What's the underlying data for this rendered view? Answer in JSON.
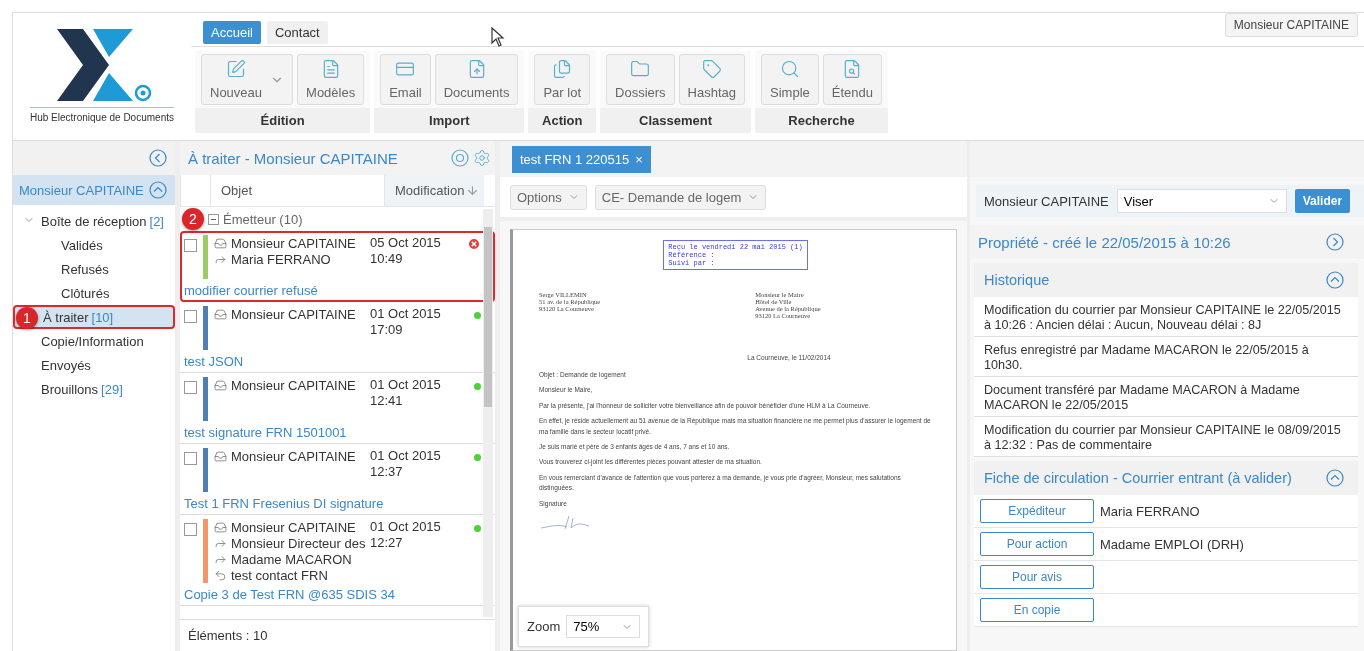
{
  "logo": {
    "caption": "Hub Electronique de Documents"
  },
  "tabs": [
    {
      "label": "Accueil",
      "selected": true
    },
    {
      "label": "Contact",
      "selected": false
    }
  ],
  "user_menu": {
    "label": "Monsieur CAPITAINE"
  },
  "ribbon": [
    {
      "title": "Édition",
      "buttons": [
        {
          "label": "Nouveau",
          "kind": "edit",
          "dropdown": true
        },
        {
          "label": "Modèles",
          "kind": "template",
          "dropdown": false
        }
      ]
    },
    {
      "title": "Import",
      "buttons": [
        {
          "label": "Email",
          "kind": "email",
          "dropdown": false
        },
        {
          "label": "Documents",
          "kind": "upload",
          "dropdown": false
        }
      ]
    },
    {
      "title": "Action",
      "buttons": [
        {
          "label": "Par lot",
          "kind": "stack",
          "dropdown": false
        }
      ]
    },
    {
      "title": "Classement",
      "buttons": [
        {
          "label": "Dossiers",
          "kind": "folder",
          "dropdown": false
        },
        {
          "label": "Hashtag",
          "kind": "tag",
          "dropdown": false
        }
      ]
    },
    {
      "title": "Recherche",
      "buttons": [
        {
          "label": "Simple",
          "kind": "search",
          "dropdown": false
        },
        {
          "label": "Étendu",
          "kind": "searchdoc",
          "dropdown": false
        }
      ]
    }
  ],
  "sidebar": {
    "account": "Monsieur CAPITAINE",
    "items": [
      {
        "label": "Boîte de réception",
        "count": "[2]",
        "selected": false,
        "expanded": true,
        "children": [
          {
            "label": "Validés",
            "selected": false
          },
          {
            "label": "Refusés",
            "selected": false
          },
          {
            "label": "Clôturés",
            "selected": false
          }
        ]
      },
      {
        "label": "À traiter",
        "count": "[10]",
        "selected": true,
        "callout": "1"
      },
      {
        "label": "Copie/Information",
        "selected": false
      },
      {
        "label": "Envoyés",
        "selected": false
      },
      {
        "label": "Brouillons",
        "count": "[29]",
        "selected": false
      }
    ]
  },
  "list": {
    "title": "À traiter - Monsieur CAPITAINE",
    "columns": [
      "Objet",
      "Modification"
    ],
    "group": "Émetteur (10)",
    "rows": [
      {
        "checked": false,
        "color": "#9ccc65",
        "kind": "refused",
        "date": "05 Oct 2015",
        "time": "10:49",
        "callout": "2",
        "lines": [
          {
            "kind": "from",
            "text": "Monsieur CAPITAINE"
          },
          {
            "kind": "to",
            "text": "Maria FERRANO"
          }
        ],
        "subject": "modifier courrier refusé"
      },
      {
        "checked": false,
        "color": "#4f7fb5",
        "kind": "ok",
        "date": "01 Oct 2015",
        "time": "17:09",
        "lines": [
          {
            "kind": "from",
            "text": "Monsieur CAPITAINE"
          }
        ],
        "subject": "test JSON"
      },
      {
        "checked": false,
        "color": "#4f7fb5",
        "kind": "ok",
        "date": "01 Oct 2015",
        "time": "12:41",
        "lines": [
          {
            "kind": "from",
            "text": "Monsieur CAPITAINE"
          }
        ],
        "subject": "test signature FRN 1501001"
      },
      {
        "checked": false,
        "color": "#4f7fb5",
        "kind": "ok",
        "date": "01 Oct 2015",
        "time": "12:37",
        "lines": [
          {
            "kind": "from",
            "text": "Monsieur CAPITAINE"
          }
        ],
        "subject": "Test 1 FRN Fresenius DI signature"
      },
      {
        "checked": false,
        "color": "#f4956a",
        "kind": "ok",
        "date": "01 Oct 2015",
        "time": "12:27",
        "lines": [
          {
            "kind": "from",
            "text": "Monsieur CAPITAINE"
          },
          {
            "kind": "to",
            "text": "Monsieur Directeur des"
          },
          {
            "kind": "to",
            "text": "Madame MACARON"
          },
          {
            "kind": "reply",
            "text": "test contact FRN"
          }
        ],
        "subject": "Copie 3 de Test FRN @635 SDIS 34"
      }
    ],
    "footer": "Éléments : 10"
  },
  "viewer": {
    "tab": "test FRN 1 220515",
    "tab_close": "×",
    "options": "Options",
    "template": "CE- Demande de logem",
    "zoom_label": "Zoom",
    "zoom": "75%",
    "document": {
      "stamp": [
        "Reçu le vendredi 22 mai 2015 (1)",
        "Référence :",
        "Suivi par :"
      ],
      "sender": [
        "Serge VILLEMIN",
        "51 av. de la République",
        "93120 La Courneuve"
      ],
      "recipient": [
        "Monsieur le Maire",
        "Hôtel de Ville",
        "Avenue de la République",
        "93120 La Courneuve"
      ],
      "date": "La Courneuve, le 11/02/2014",
      "paragraphs": [
        "Objet : Demande de logement",
        "Monsieur le Maire,",
        "Par la présente, j'ai l'honneur de solliciter votre bienveillance afin de pouvoir bénéficier d'une HLM à La Courneuve.",
        "En effet, je réside actuellement au 51 avenue de la République mais ma situation financière ne me permet plus d'assurer le logement de ma famille dans le secteur locatif privé.",
        "Je suis marié et père de 3 enfants âgés de 4 ans, 7 ans et 10 ans.",
        "Vous trouverez ci-joint les différentes pièces pouvant attester de ma situation.",
        "En vous remerciant d'avance de l'attention que vous porterez à ma demande, je vous prie d'agréer, Monsieur, mes salutations distinguées.",
        "Signature"
      ]
    }
  },
  "details": {
    "actor": "Monsieur CAPITAINE",
    "action": "Viser",
    "submit": "Valider",
    "properties": "Propriété - créé le 22/05/2015 à 10:26",
    "history": {
      "title": "Historique",
      "expanded": true,
      "entries": [
        "Modification du courrier par Monsieur CAPITAINE le 22/05/2015 à 10:26 : Ancien délai : Aucun, Nouveau délai : 8J",
        "Refus enregistré par Madame MACARON le 22/05/2015 à 10h30.",
        "Document transféré par Madame MACARON à Madame MACARON le 22/05/2015",
        "Modification du courrier par Monsieur CAPITAINE le 08/09/2015 à 12:32 : Pas de commentaire"
      ]
    },
    "routing": {
      "title": "Fiche de circulation - Courrier entrant (à valider)",
      "expanded": true,
      "rows": [
        {
          "role": "Expéditeur",
          "value": "Maria FERRANO"
        },
        {
          "role": "Pour action",
          "value": "Madame EMPLOI (DRH)"
        },
        {
          "role": "Pour avis"
        },
        {
          "role": "En copie"
        }
      ]
    }
  }
}
